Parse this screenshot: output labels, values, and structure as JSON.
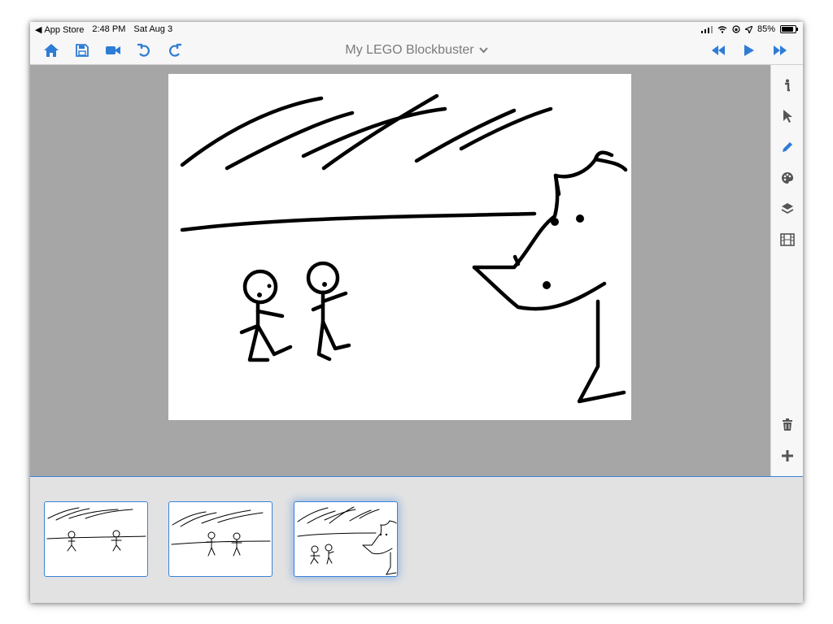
{
  "status_bar": {
    "back_app": "App Store",
    "time": "2:48 PM",
    "date": "Sat Aug 3",
    "battery": "85%",
    "battery_level": 0.85
  },
  "toolbar": {
    "title": "My LEGO Blockbuster",
    "left_icons": [
      "home-icon",
      "save-icon",
      "video-camera-icon",
      "undo-icon",
      "redo-icon"
    ],
    "right_icons": [
      "rewind-icon",
      "play-icon",
      "fast-forward-icon"
    ],
    "accent_color": "#2e7cd6"
  },
  "sidebar": {
    "tools": [
      "info-icon",
      "pointer-icon",
      "pencil-icon",
      "palette-icon",
      "layers-icon",
      "film-icon"
    ],
    "bottom_tools": [
      "trash-icon",
      "add-icon"
    ],
    "active_tool": "pencil-icon"
  },
  "filmstrip": {
    "frame_count": 3,
    "selected_frame": 3
  }
}
